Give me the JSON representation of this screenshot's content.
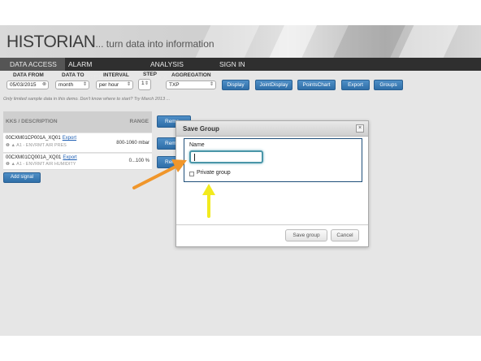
{
  "header": {
    "brand_main": "HISTORIAN",
    "brand_tagline": "... turn data into information"
  },
  "nav": {
    "items": [
      {
        "label": "DATA ACCESS",
        "active": true
      },
      {
        "label": "ALARM MANAGEMENT",
        "active": false
      },
      {
        "label": "ANALYSIS TOOLS",
        "active": false
      },
      {
        "label": "SIGN IN",
        "active": false
      }
    ]
  },
  "filters": {
    "data_from_label": "DATA FROM",
    "data_from_value": "05/03/2015",
    "data_to_label": "DATA TO",
    "data_to_value": "month",
    "interval_label": "INTERVAL",
    "interval_value": "per hour",
    "step_label": "STEP",
    "step_value": "1",
    "aggregation_label": "AGGREGATION",
    "aggregation_value": "TXP"
  },
  "toolbar": {
    "display": "Display",
    "joint_display": "JointDisplay",
    "points_chart": "PointsChart",
    "export": "Export",
    "groups": "Groups"
  },
  "hint": "Only limited sample data in this demo. Don't know where to start? Try March 2013 ...",
  "table": {
    "col_kks": "KKS / DESCRIPTION",
    "col_range": "RANGE",
    "rows": [
      {
        "tag": "00CXM01CP001A_XQ01",
        "export": "Export",
        "desc": "A1 - ENVRMT AIR PRES",
        "range": "800-1060 mbar",
        "remove": "Remo"
      },
      {
        "tag": "00CXM01CQ001A_XQ01",
        "export": "Export",
        "desc": "A1 - ENVRMT AIR HUMIDITY",
        "range": "0...100 %",
        "remove": "Remo"
      }
    ],
    "header_remove": "Remo"
  },
  "add_signal": "Add signal",
  "modal": {
    "title": "Save Group",
    "close": "×",
    "name_label": "Name",
    "name_value": "",
    "private_label": "Private group",
    "save_button": "Save group",
    "cancel_button": "Cancel"
  },
  "colors": {
    "primary_button": "#3a7dba",
    "nav_bg": "#2f2f2f",
    "annotation_orange": "#f0962b",
    "annotation_yellow": "#f2ea1e"
  }
}
